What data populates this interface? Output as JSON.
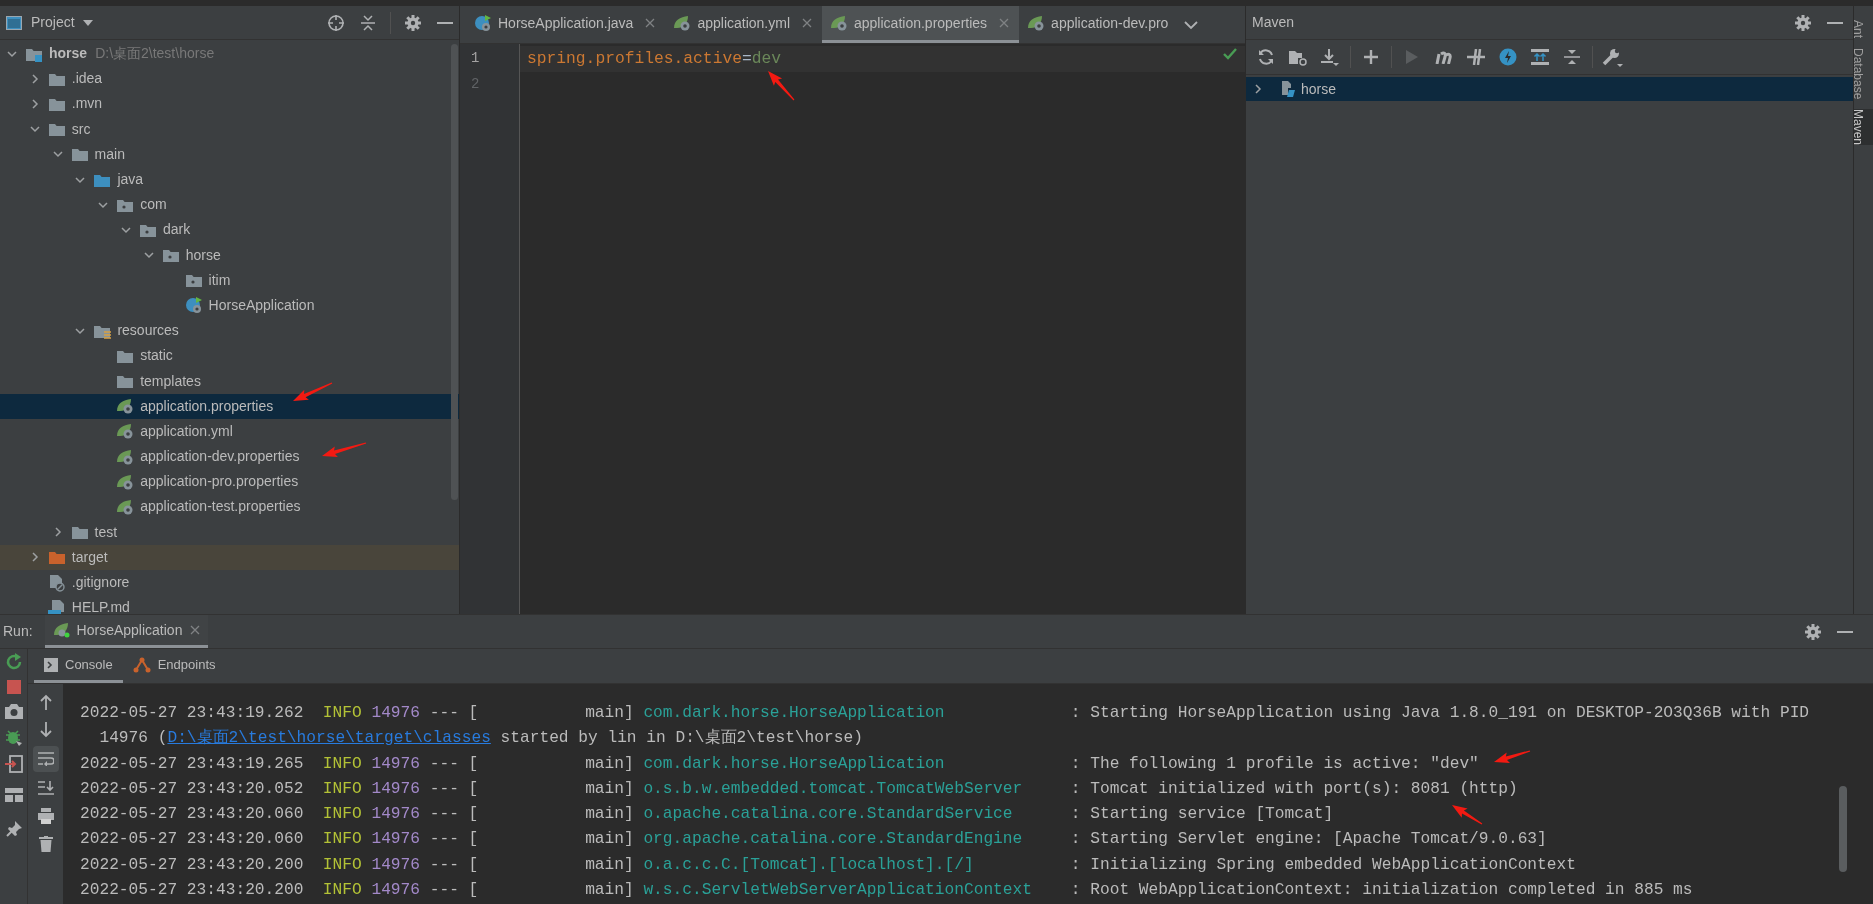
{
  "project_panel": {
    "title": "Project",
    "tree": [
      {
        "label": "horse",
        "path": "D:\\桌面2\\test\\horse",
        "kind": "module",
        "expanded": true,
        "selected": false,
        "children": [
          {
            "label": ".idea",
            "kind": "folder",
            "expanded": false,
            "selected": false
          },
          {
            "label": ".mvn",
            "kind": "folder",
            "expanded": false,
            "selected": false
          },
          {
            "label": "src",
            "kind": "folder",
            "expanded": true,
            "selected": false,
            "children": [
              {
                "label": "main",
                "kind": "folder",
                "expanded": true,
                "selected": false,
                "children": [
                  {
                    "label": "java",
                    "kind": "source-folder",
                    "expanded": true,
                    "selected": false,
                    "children": [
                      {
                        "label": "com",
                        "kind": "package",
                        "expanded": true,
                        "selected": false,
                        "children": [
                          {
                            "label": "dark",
                            "kind": "package",
                            "expanded": true,
                            "selected": false,
                            "children": [
                              {
                                "label": "horse",
                                "kind": "package",
                                "expanded": true,
                                "selected": false,
                                "children": [
                                  {
                                    "label": "itim",
                                    "kind": "package",
                                    "selected": false
                                  },
                                  {
                                    "label": "HorseApplication",
                                    "kind": "spring-boot-class",
                                    "selected": false
                                  }
                                ]
                              }
                            ]
                          }
                        ]
                      }
                    ]
                  },
                  {
                    "label": "resources",
                    "kind": "resources-folder",
                    "expanded": true,
                    "selected": false,
                    "children": [
                      {
                        "label": "static",
                        "kind": "folder",
                        "selected": false
                      },
                      {
                        "label": "templates",
                        "kind": "folder",
                        "selected": false
                      },
                      {
                        "label": "application.properties",
                        "kind": "spring-config",
                        "selected": true
                      },
                      {
                        "label": "application.yml",
                        "kind": "spring-config",
                        "selected": false
                      },
                      {
                        "label": "application-dev.properties",
                        "kind": "spring-config",
                        "selected": false
                      },
                      {
                        "label": "application-pro.properties",
                        "kind": "spring-config",
                        "selected": false
                      },
                      {
                        "label": "application-test.properties",
                        "kind": "spring-config",
                        "selected": false
                      }
                    ]
                  }
                ]
              },
              {
                "label": "test",
                "kind": "folder",
                "expanded": false,
                "selected": false
              }
            ]
          },
          {
            "label": "target",
            "kind": "excluded-folder",
            "expanded": false,
            "selected": false
          },
          {
            "label": ".gitignore",
            "kind": "gitignore",
            "selected": false
          },
          {
            "label": "HELP.md",
            "kind": "markdown",
            "selected": false
          }
        ]
      }
    ]
  },
  "editor": {
    "tabs": [
      {
        "label": "HorseApplication.java",
        "kind": "spring-boot-class",
        "selected": false,
        "closable": true
      },
      {
        "label": "application.yml",
        "kind": "spring-config",
        "selected": false,
        "closable": true
      },
      {
        "label": "application.properties",
        "kind": "spring-config",
        "selected": true,
        "closable": true
      },
      {
        "label": "application-dev.pro",
        "kind": "spring-config",
        "selected": false,
        "closable": false
      }
    ],
    "lines": [
      {
        "number": "1",
        "current": true,
        "tokens": [
          {
            "kind": "key",
            "text": "spring.profiles.active"
          },
          {
            "kind": "operator",
            "text": "="
          },
          {
            "kind": "value",
            "text": "dev"
          }
        ]
      },
      {
        "number": "2",
        "current": false
      }
    ]
  },
  "maven_panel": {
    "title": "Maven",
    "projects": [
      {
        "label": "horse",
        "expanded": false,
        "selected": true
      }
    ]
  },
  "side_stripe": [
    {
      "label": "Ant",
      "selected": false
    },
    {
      "label": "Database",
      "selected": false
    },
    {
      "label": "Maven",
      "selected": true
    }
  ],
  "run_panel": {
    "label": "Run:",
    "tabs": [
      {
        "label": "HorseApplication",
        "selected": true
      }
    ],
    "subtabs": [
      {
        "label": "Console",
        "kind": "console",
        "selected": true
      },
      {
        "label": "Endpoints",
        "kind": "endpoints",
        "selected": false
      }
    ],
    "soft_wrap": true,
    "console_lines": [
      {
        "kind": "log",
        "time": "2022-05-27 23:43:19.262",
        "level": "INFO",
        "pid": "14976",
        "thread": "--- [           main]",
        "logger": "com.dark.horse.HorseApplication",
        "message": ": Starting HorseApplication using Java 1.8.0_191 on DESKTOP-2O3Q36B with PID"
      },
      {
        "kind": "continuation",
        "before": "14976 (",
        "link": "D:\\桌面2\\test\\horse\\target\\classes",
        "after": " started by lin in D:\\桌面2\\test\\horse)"
      },
      {
        "kind": "log",
        "time": "2022-05-27 23:43:19.265",
        "level": "INFO",
        "pid": "14976",
        "thread": "--- [           main]",
        "logger": "com.dark.horse.HorseApplication",
        "message": ": The following 1 profile is active: \"dev\""
      },
      {
        "kind": "log",
        "time": "2022-05-27 23:43:20.052",
        "level": "INFO",
        "pid": "14976",
        "thread": "--- [           main]",
        "logger": "o.s.b.w.embedded.tomcat.TomcatWebServer",
        "message": ": Tomcat initialized with port(s): 8081 (http)"
      },
      {
        "kind": "log",
        "time": "2022-05-27 23:43:20.060",
        "level": "INFO",
        "pid": "14976",
        "thread": "--- [           main]",
        "logger": "o.apache.catalina.core.StandardService",
        "message": ": Starting service [Tomcat]"
      },
      {
        "kind": "log",
        "time": "2022-05-27 23:43:20.060",
        "level": "INFO",
        "pid": "14976",
        "thread": "--- [           main]",
        "logger": "org.apache.catalina.core.StandardEngine",
        "message": ": Starting Servlet engine: [Apache Tomcat/9.0.63]"
      },
      {
        "kind": "log",
        "time": "2022-05-27 23:43:20.200",
        "level": "INFO",
        "pid": "14976",
        "thread": "--- [           main]",
        "logger": "o.a.c.c.C.[Tomcat].[localhost].[/]",
        "message": ": Initializing Spring embedded WebApplicationContext"
      },
      {
        "kind": "log",
        "time": "2022-05-27 23:43:20.200",
        "level": "INFO",
        "pid": "14976",
        "thread": "--- [           main]",
        "logger": "w.s.c.ServletWebServerApplicationContext",
        "message": ": Root WebApplicationContext: initialization completed in 885 ms"
      }
    ]
  }
}
